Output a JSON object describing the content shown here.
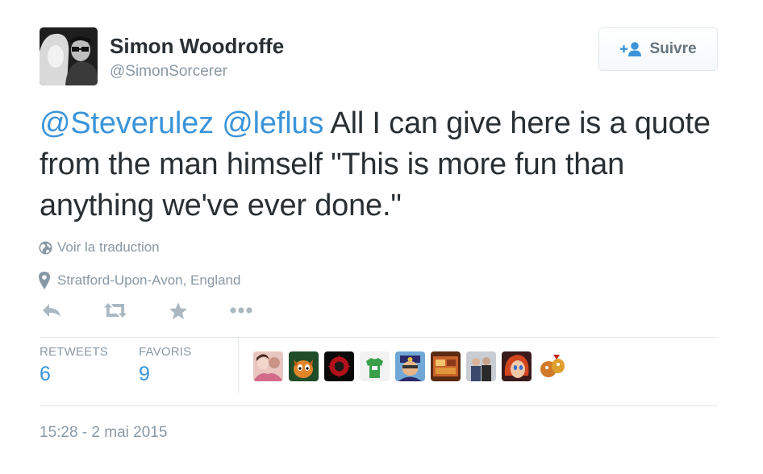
{
  "author": {
    "name": "Simon Woodroffe",
    "handle": "@SimonSorcerer",
    "avatar_icon": "user-avatar"
  },
  "follow": {
    "label": "Suivre",
    "icon": "add-user-icon"
  },
  "tweet": {
    "mentions": [
      "@Steverulez",
      "@leflus"
    ],
    "text": "All I can give here is a quote from the man himself \"This is more fun than anything we've ever done.\""
  },
  "translate": {
    "label": "Voir la traduction",
    "icon": "globe-icon"
  },
  "location": {
    "label": "Stratford-Upon-Avon, England",
    "icon": "map-pin-icon"
  },
  "actions": [
    "reply-icon",
    "retweet-icon",
    "favorite-icon",
    "more-icon"
  ],
  "stats": {
    "retweets": {
      "label": "RETWEETS",
      "value": "6"
    },
    "favorites": {
      "label": "FAVORIS",
      "value": "9"
    }
  },
  "favoriters_count": 9,
  "timestamp": "15:28 - 2 mai 2015",
  "colors": {
    "link": "#3b94d9",
    "muted": "#8899a6",
    "text": "#292f33",
    "border": "#e1e8ed"
  }
}
